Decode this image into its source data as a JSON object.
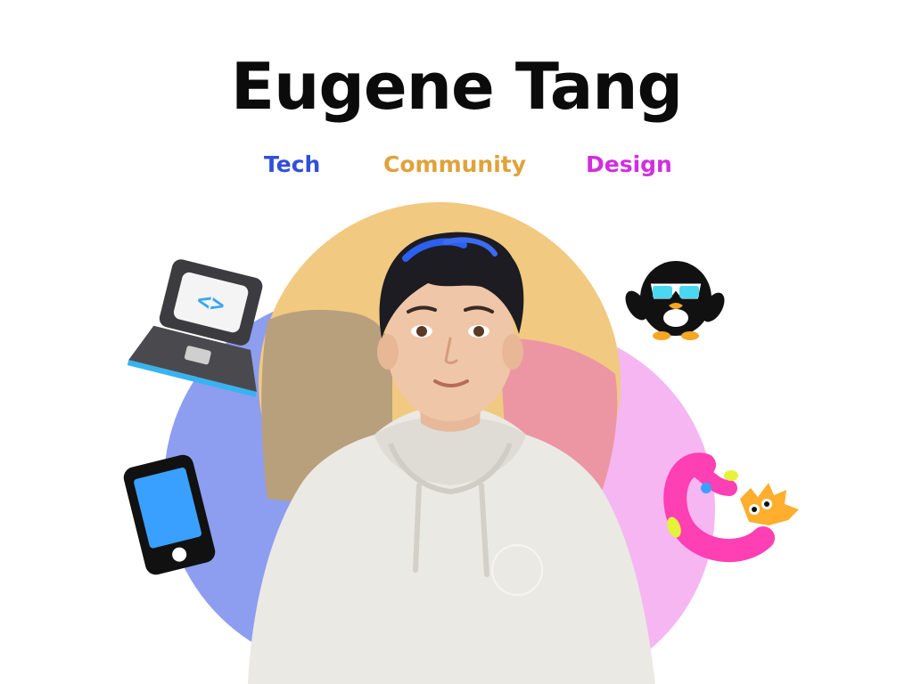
{
  "profile": {
    "name": "Eugene Tang"
  },
  "tags": [
    {
      "label": "Tech",
      "color": "#2f4fdc"
    },
    {
      "label": "Community",
      "color": "#e0a23a"
    },
    {
      "label": "Design",
      "color": "#d12ee0"
    }
  ],
  "venn": {
    "tech_color": "#8b9cf0",
    "community_color": "#f2c97e",
    "design_color": "#f6b5f0"
  },
  "icons": [
    "laptop-code-icon",
    "smartphone-icon",
    "penguin-sunglasses-icon",
    "squiggle-character-icon"
  ],
  "avatar": {
    "hoodie_color": "#ecebe6",
    "hair_color": "#1c1c22"
  }
}
